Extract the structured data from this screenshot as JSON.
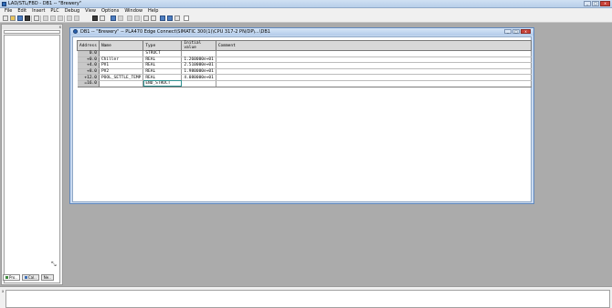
{
  "app": {
    "title": "LAD/STL/FBD  - DB1 -- \"Brewery\"",
    "window_buttons": [
      "_",
      "□",
      "x"
    ]
  },
  "menu": [
    "File",
    "Edit",
    "Insert",
    "PLC",
    "Debug",
    "View",
    "Options",
    "Window",
    "Help"
  ],
  "toolbar": {
    "icons": [
      "new-icon",
      "open-icon",
      "open-online-icon",
      "save-icon",
      "print-icon",
      "cut-icon",
      "copy-icon",
      "paste-icon",
      "download-icon",
      "undo-icon",
      "redo-icon",
      "monitor-icon",
      "network-icon",
      "overview-icon",
      "help-icon"
    ]
  },
  "left_panel": {
    "close_label": "x",
    "tabs": [
      {
        "label": "Pro..",
        "icon": "program-elements-icon"
      },
      {
        "label": "Cal..",
        "icon": "call-structure-icon"
      },
      {
        "label": "Ne..",
        "icon": "network-icon"
      }
    ]
  },
  "db_window": {
    "title": "DB1 -- \"Brewery\" -- PLA470 Edge Connect\\SIMATIC 300(1)\\CPU 317-2 PN/DP\\...\\DB1",
    "buttons": [
      "_",
      "□",
      "x"
    ],
    "columns": [
      "Address",
      "Name",
      "Type",
      "Initial value",
      "Comment"
    ],
    "rows": [
      {
        "address": "0.0",
        "name": "",
        "type": "STRUCT",
        "initial": "",
        "comment": ""
      },
      {
        "address": "+0.0",
        "name": "Chiller",
        "type": "REAL",
        "initial": "1.260000e+01",
        "comment": ""
      },
      {
        "address": "+4.0",
        "name": "PV1",
        "type": "REAL",
        "initial": "2.510000e+01",
        "comment": ""
      },
      {
        "address": "+8.0",
        "name": "PV2",
        "type": "REAL",
        "initial": "1.980000e+01",
        "comment": ""
      },
      {
        "address": "+12.0",
        "name": "POOL_SETTLE_TEMP",
        "type": "REAL",
        "initial": "4.080000e+01",
        "comment": ""
      },
      {
        "address": "=16.0",
        "name": "",
        "type": "END_STRUCT",
        "initial": "",
        "comment": ""
      }
    ]
  },
  "bottom_panel": {
    "close_label": "x"
  }
}
